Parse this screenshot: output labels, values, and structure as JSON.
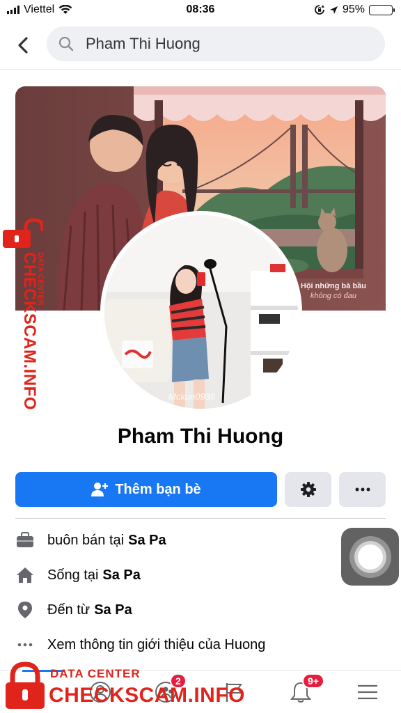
{
  "status_bar": {
    "carrier": "Viettel",
    "time": "08:36",
    "battery_percent": "95%",
    "battery_level": 0.95,
    "icons": [
      "signal-icon",
      "wifi-icon",
      "rotation-lock-icon",
      "location-arrow-icon",
      "battery-icon"
    ]
  },
  "nav": {
    "back_icon": "chevron-left-icon",
    "search_icon": "search-icon",
    "search_value": "Pham Thi Huong"
  },
  "cover": {
    "caption_line1": "Hội những bà bầu",
    "caption_line2": "không có đau"
  },
  "avatar": {
    "watermark": "Mckun0936"
  },
  "profile": {
    "name": "Pham Thi Huong"
  },
  "actions": {
    "add_friend_label": "Thêm bạn bè",
    "add_friend_icon": "add-person-icon",
    "settings_icon": "gear-icon",
    "more_icon": "ellipsis-icon",
    "primary_color": "#1877f2"
  },
  "about": {
    "work": {
      "prefix": "buôn bán tại",
      "place": "Sa Pa",
      "icon": "briefcase-icon"
    },
    "lives": {
      "prefix": "Sống tại",
      "place": "Sa Pa",
      "icon": "house-icon"
    },
    "from": {
      "prefix": "Đến từ",
      "place": "Sa Pa",
      "icon": "location-pin-icon"
    },
    "see_more": {
      "label": "Xem thông tin giới thiệu của Huong",
      "icon": "ellipsis-icon"
    }
  },
  "tab_bar": {
    "tabs": [
      {
        "icon": "home-icon"
      },
      {
        "icon": "friends-icon"
      },
      {
        "icon": "groups-icon",
        "badge": "2"
      },
      {
        "icon": "pages-flag-icon"
      },
      {
        "icon": "bell-icon",
        "badge": "9+"
      },
      {
        "icon": "menu-icon"
      }
    ]
  },
  "watermark": {
    "brand_small": "DATA CENTER",
    "brand_large": "CHECKSCAM.INFO",
    "color": "#e0241b"
  }
}
